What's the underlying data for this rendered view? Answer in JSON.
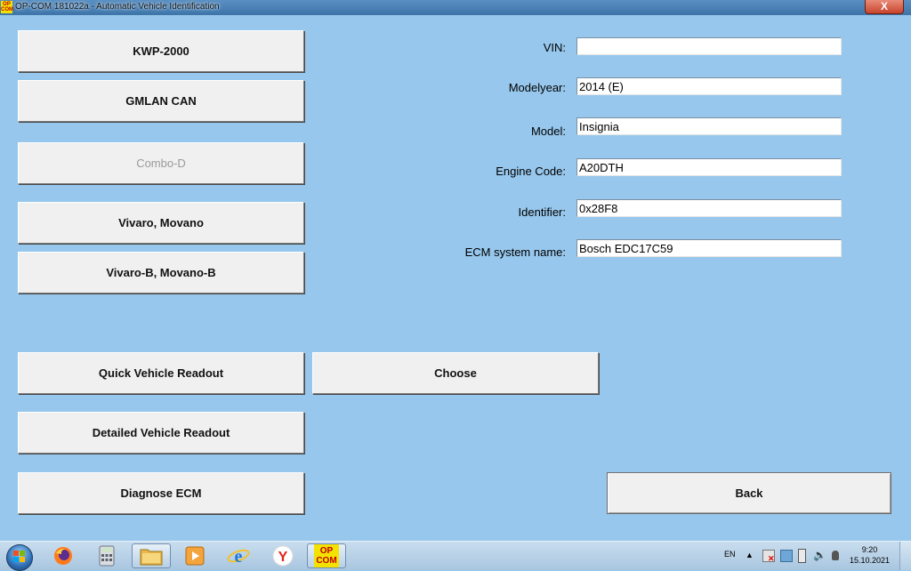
{
  "window": {
    "title": "OP-COM 181022a - Automatic Vehicle Identification",
    "icon_text": "OP COM",
    "close_label": "X"
  },
  "buttons": {
    "kwp2000": "KWP-2000",
    "gmlan_can": "GMLAN CAN",
    "combo_d": "Combo-D",
    "vivaro_movano": "Vivaro, Movano",
    "vivaro_b_movano_b": "Vivaro-B, Movano-B",
    "quick_readout": "Quick Vehicle Readout",
    "choose": "Choose",
    "detailed_readout": "Detailed Vehicle Readout",
    "diagnose_ecm": "Diagnose ECM",
    "back": "Back"
  },
  "fields": {
    "vin": {
      "label": "VIN:",
      "value": ""
    },
    "modelyear": {
      "label": "Modelyear:",
      "value": "2014 (E)"
    },
    "model": {
      "label": "Model:",
      "value": "Insignia"
    },
    "engine_code": {
      "label": "Engine Code:",
      "value": "A20DTH"
    },
    "identifier": {
      "label": "Identifier:",
      "value": "0x28F8"
    },
    "ecm_system_name": {
      "label": "ECM system name:",
      "value": "Bosch EDC17C59"
    }
  },
  "taskbar": {
    "language": "EN",
    "time": "9:20",
    "date": "15.10.2021",
    "opcom_icon_text": "OP COM",
    "icons": [
      "firefox-icon",
      "calculator-icon",
      "file-explorer-icon",
      "media-player-icon",
      "internet-explorer-icon",
      "yandex-browser-icon",
      "opcom-icon"
    ]
  },
  "colors": {
    "background": "#97c7ec",
    "button_face": "#f0f0f0",
    "disabled_text": "#9a9a9a"
  }
}
